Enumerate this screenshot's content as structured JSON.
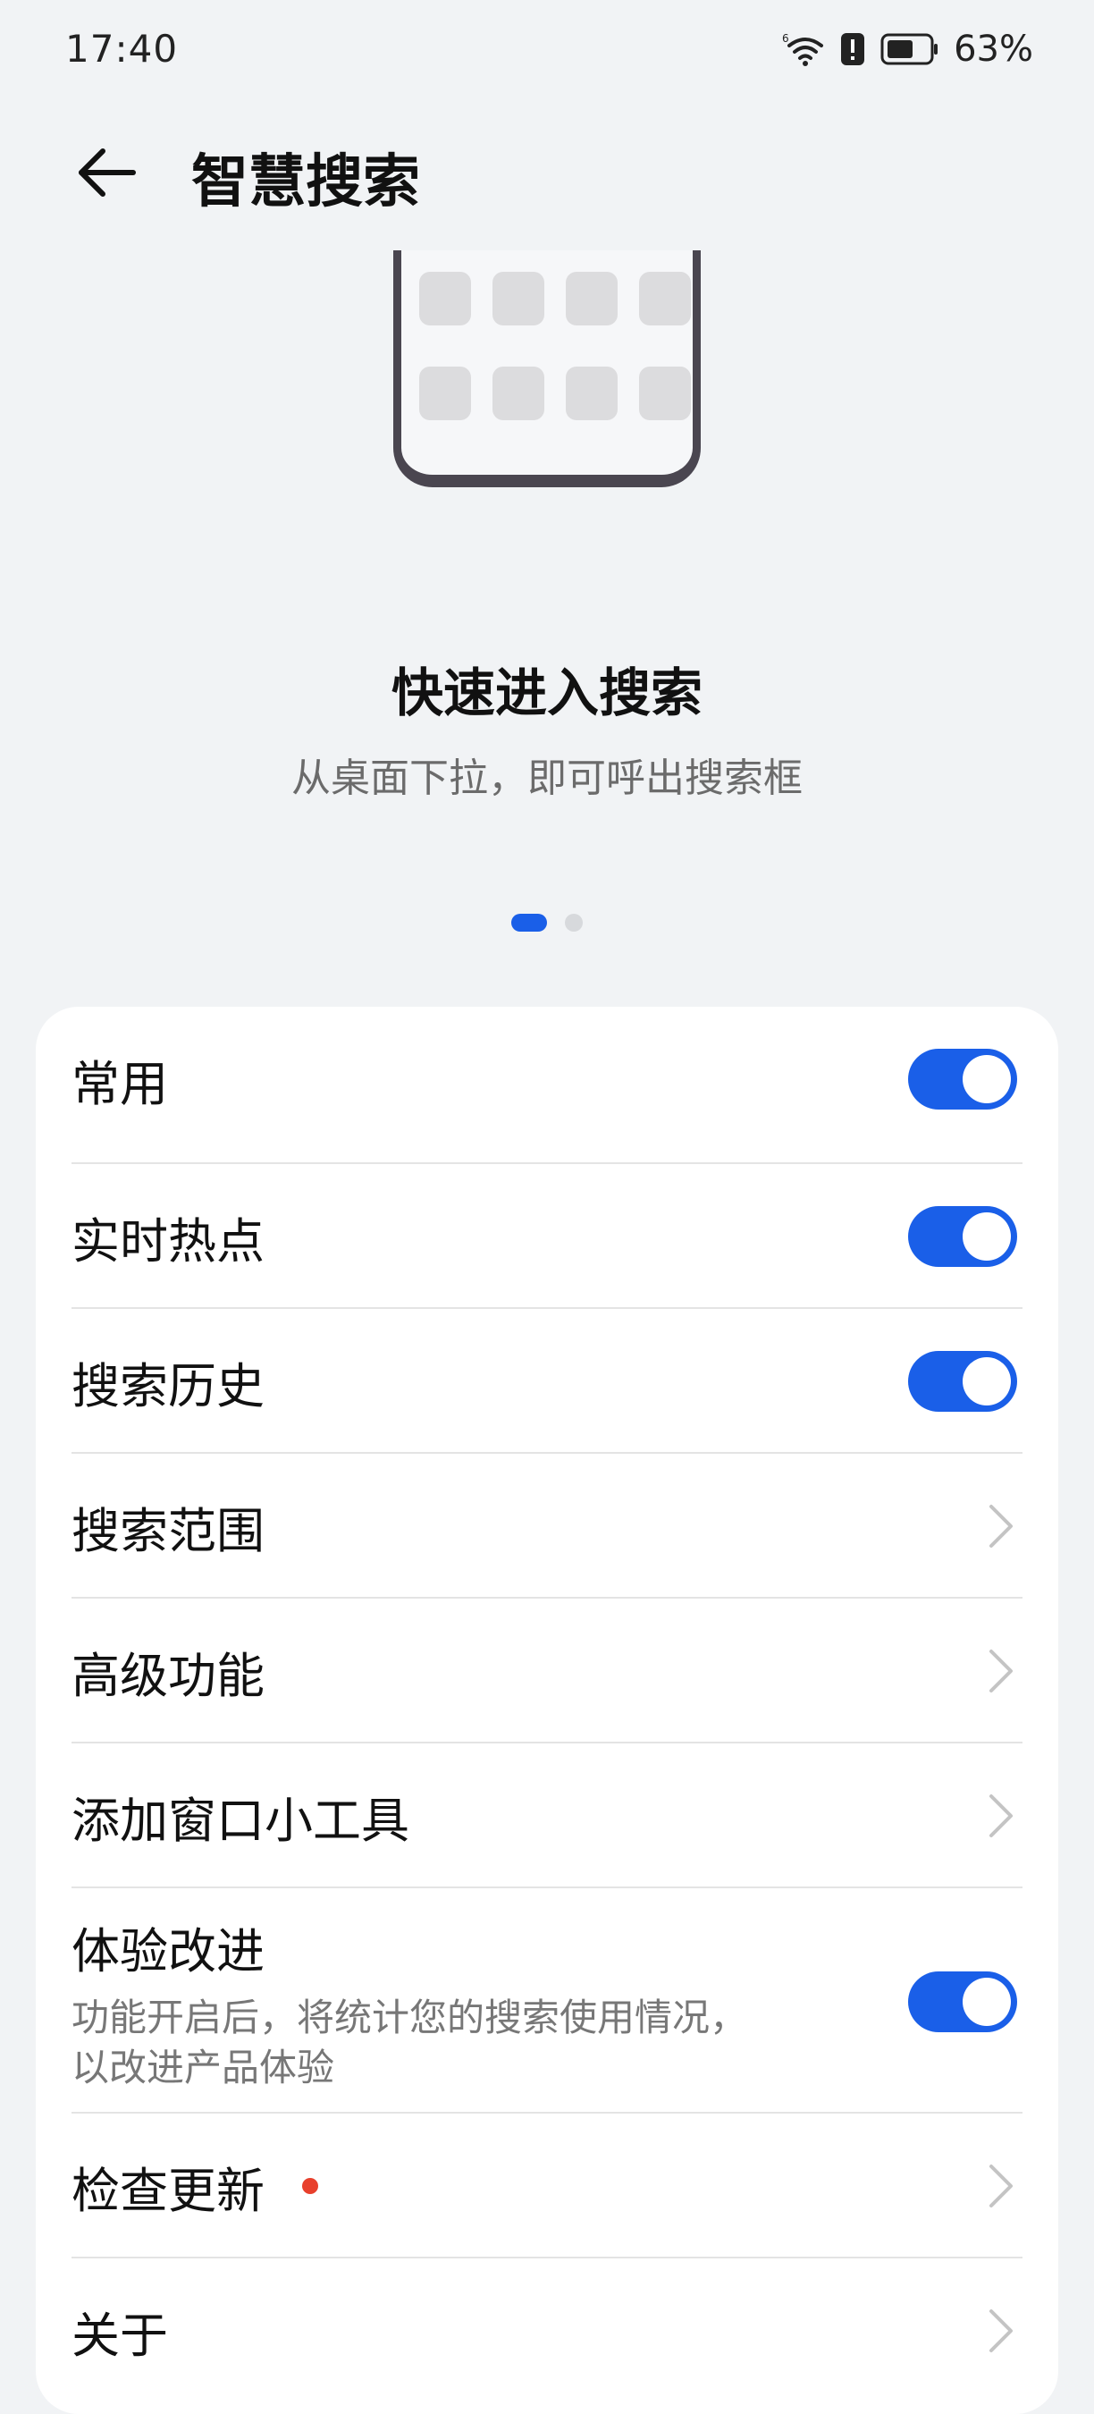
{
  "status_bar": {
    "time": "17:40",
    "battery_percent": "63%",
    "battery_level": 0.63,
    "icons": [
      "wifi-6-icon",
      "alert-icon",
      "battery-icon"
    ]
  },
  "header": {
    "title": "智慧搜索",
    "back_icon": "back-arrow-icon"
  },
  "carousel": {
    "title": "快速进入搜索",
    "subtitle": "从桌面下拉，即可呼出搜索框",
    "page_count": 2,
    "active_page": 1
  },
  "settings": {
    "items": [
      {
        "label": "常用",
        "control": "toggle",
        "on": true
      },
      {
        "label": "实时热点",
        "control": "toggle",
        "on": true
      },
      {
        "label": "搜索历史",
        "control": "toggle",
        "on": true
      },
      {
        "label": "搜索范围",
        "control": "chevron"
      },
      {
        "label": "高级功能",
        "control": "chevron"
      },
      {
        "label": "添加窗口小工具",
        "control": "chevron"
      },
      {
        "label": "体验改进",
        "description": "功能开启后，将统计您的搜索使用情况，以改进产品体验",
        "description_line1": "功能开启后，将统计您的搜索使用情况，",
        "description_line2": "以改进产品体验",
        "control": "toggle",
        "on": true
      },
      {
        "label": "检查更新",
        "control": "chevron",
        "badge": "red-dot"
      },
      {
        "label": "关于",
        "control": "chevron"
      }
    ]
  },
  "colors": {
    "accent": "#1a5fe8",
    "background": "#f1f3f5",
    "card": "#ffffff",
    "badge": "#e8402c"
  }
}
